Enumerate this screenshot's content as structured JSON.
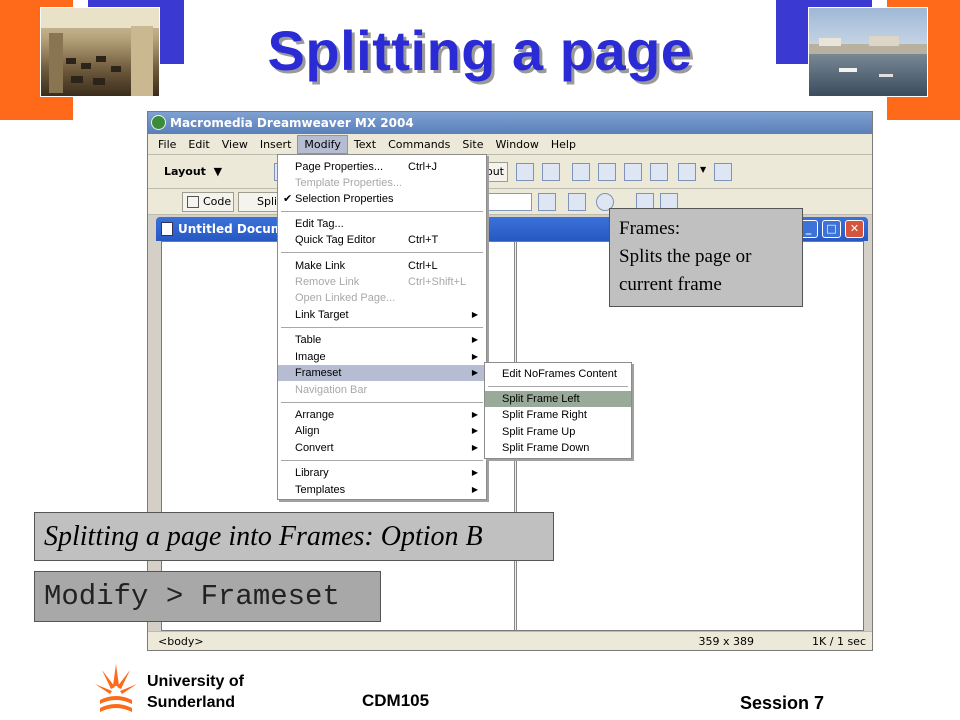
{
  "slide": {
    "title": "Splitting a page",
    "colors": {
      "title": "#2b2bd6",
      "orange": "#ff6a1a",
      "blue": "#3a3ad2"
    }
  },
  "app": {
    "title": "Macromedia Dreamweaver MX 2004",
    "menubar": [
      "File",
      "Edit",
      "View",
      "Insert",
      "Modify",
      "Text",
      "Commands",
      "Site",
      "Window",
      "Help"
    ],
    "insert_bar": {
      "category": "Layout",
      "out_button": "out"
    },
    "doc_toolbar": {
      "code_button": "Code",
      "split_button": "Split"
    },
    "document": {
      "title": "Untitled Docume"
    },
    "status": {
      "tag": "<body>",
      "size": "359 x 389",
      "download": "1K / 1 sec"
    }
  },
  "modify_menu": {
    "items": [
      {
        "label": "Page Properties...",
        "shortcut": "Ctrl+J"
      },
      {
        "label": "Template Properties...",
        "disabled": true
      },
      {
        "label": "Selection Properties",
        "checked": true
      },
      {
        "label": "Edit Tag..."
      },
      {
        "label": "Quick Tag Editor",
        "shortcut": "Ctrl+T"
      },
      {
        "label": "Make Link",
        "shortcut": "Ctrl+L"
      },
      {
        "label": "Remove Link",
        "shortcut": "Ctrl+Shift+L",
        "disabled": true
      },
      {
        "label": "Open Linked Page...",
        "disabled": true
      },
      {
        "label": "Link Target",
        "submenu": true
      },
      {
        "label": "Table",
        "submenu": true
      },
      {
        "label": "Image",
        "submenu": true
      },
      {
        "label": "Frameset",
        "submenu": true,
        "highlighted": true
      },
      {
        "label": "Navigation Bar",
        "disabled": true
      },
      {
        "label": "Arrange",
        "submenu": true
      },
      {
        "label": "Align",
        "submenu": true
      },
      {
        "label": "Convert",
        "submenu": true
      },
      {
        "label": "Library",
        "submenu": true
      },
      {
        "label": "Templates",
        "submenu": true
      }
    ]
  },
  "frameset_submenu": {
    "items": [
      {
        "label": "Edit NoFrames Content"
      },
      {
        "label": "Split Frame Left",
        "highlighted": true
      },
      {
        "label": "Split Frame Right"
      },
      {
        "label": "Split Frame Up"
      },
      {
        "label": "Split Frame Down"
      }
    ]
  },
  "callouts": {
    "frames_line1": "Frames:",
    "frames_line2": "Splits the page or",
    "frames_line3": "current frame",
    "option": "Splitting a page into Frames: Option B",
    "path": "Modify > Frameset"
  },
  "footer": {
    "university_line1": "University of",
    "university_line2": "Sunderland",
    "course": "CDM105",
    "session": "Session 7"
  }
}
